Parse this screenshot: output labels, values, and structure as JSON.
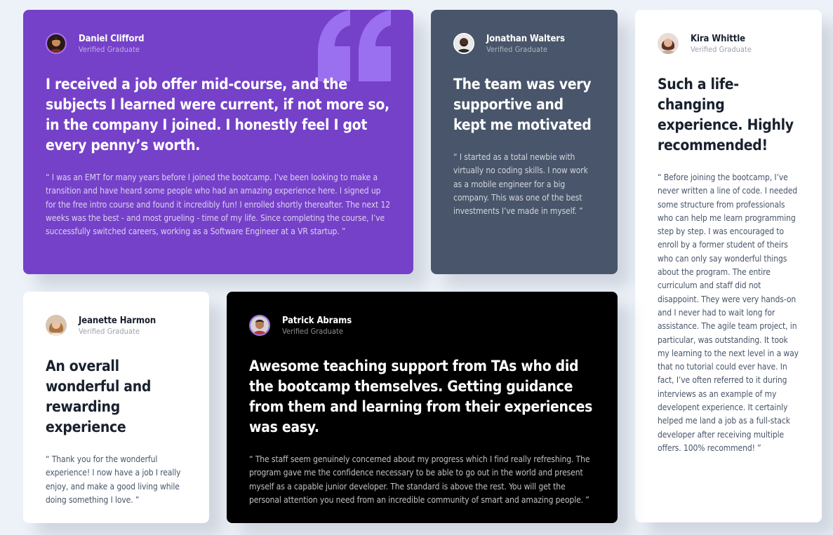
{
  "colors": {
    "page_bg": "#edf2f8",
    "purple": "#7541c8",
    "slate": "#48556a",
    "white": "#ffffff",
    "black": "#000000"
  },
  "testimonials": [
    {
      "name": "Daniel Clifford",
      "role": "Verified Graduate",
      "headline": "I received a job offer mid-course, and the subjects I learned were current, if not more so, in the company I joined. I honestly feel I got every penny’s worth.",
      "body": "“ I was an EMT for many years before I joined the bootcamp. I’ve been looking to make a transition and have heard some people who had an amazing experience here. I signed up for the free intro course and found it incredibly fun! I enrolled shortly thereafter. The next 12 weeks was the best - and most grueling - time of my life. Since completing the course, I’ve successfully switched careers, working as a Software Engineer at a VR startup. ”"
    },
    {
      "name": "Jonathan Walters",
      "role": "Verified Graduate",
      "headline": "The team was very supportive and kept me motivated",
      "body": "“ I started as a total newbie with virtually no coding skills. I now work as a mobile engineer for a big company. This was one of the best investments I’ve made in myself. ”"
    },
    {
      "name": "Kira Whittle",
      "role": "Verified Graduate",
      "headline": "Such a life-changing experience. Highly recommended!",
      "body": "“ Before joining the bootcamp, I’ve never written a line of code. I needed some structure from professionals who can help me learn programming step by step. I was encouraged to enroll by a former student of theirs who can only say wonderful things about the program. The entire curriculum and staff did not disappoint. They were very hands-on and I never had to wait long for assistance. The agile team project, in particular, was outstanding. It took my learning to the next level in a way that no tutorial could ever have. In fact, I’ve often referred to it during interviews as an example of my developent experience. It certainly helped me land a job as a full-stack developer after receiving multiple offers. 100% recommend! ”"
    },
    {
      "name": "Jeanette Harmon",
      "role": "Verified Graduate",
      "headline": "An overall wonderful and rewarding experience",
      "body": "“ Thank you for the wonderful experience! I now have a job I really enjoy, and make a good living while doing something I love. ”"
    },
    {
      "name": "Patrick Abrams",
      "role": "Verified Graduate",
      "headline": "Awesome teaching support from TAs who did the bootcamp themselves. Getting guidance from them and learning from their experiences was easy.",
      "body": "“ The staff seem genuinely concerned about my progress which I find really refreshing. The program gave me the confidence necessary to be able to go out in the world and present myself as a capable junior developer. The standard is above the rest. You will get the personal attention you need from an incredible community of smart and amazing people. ”"
    }
  ]
}
